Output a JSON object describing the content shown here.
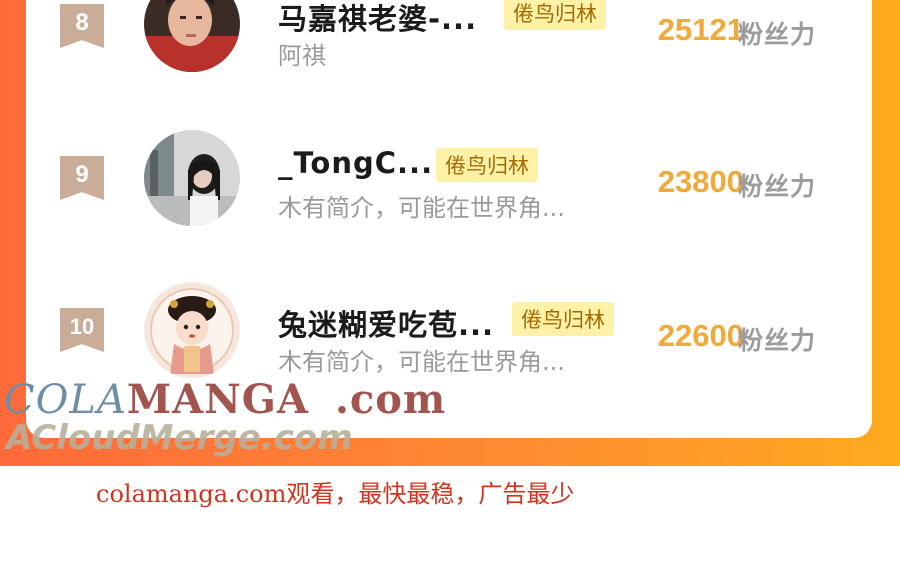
{
  "ranking": {
    "rows": [
      {
        "rank": "8",
        "name": "马嘉祺老婆-...",
        "tag": "倦鸟归林",
        "intro": "阿祺",
        "score": "25121",
        "unit": "粉丝力"
      },
      {
        "rank": "9",
        "name": "_TongC...",
        "tag": "倦鸟归林",
        "intro": "木有简介，可能在世界角...",
        "score": "23800",
        "unit": "粉丝力"
      },
      {
        "rank": "10",
        "name": "兔迷糊爱吃苞...",
        "tag": "倦鸟归林",
        "intro": "木有简介，可能在世界角...",
        "score": "22600",
        "unit": "粉丝力"
      }
    ]
  },
  "watermark": {
    "part1": "COLA",
    "part2": "MANGA",
    "part3": ".com",
    "line2": "ACloudMerge.com"
  },
  "promo": {
    "text": "colamanga.com观看，最快最稳，广告最少"
  },
  "colors": {
    "banner_start": "#ff6a3a",
    "banner_end": "#ffab1e",
    "score": "#f1a93a",
    "tag_bg": "#fff1a8",
    "rank_bg": "#c9ad98",
    "promo": "#d2331f"
  },
  "avatars": [
    "portrait-photo-avatar",
    "girl-photo-avatar",
    "cartoon-girl-avatar"
  ]
}
